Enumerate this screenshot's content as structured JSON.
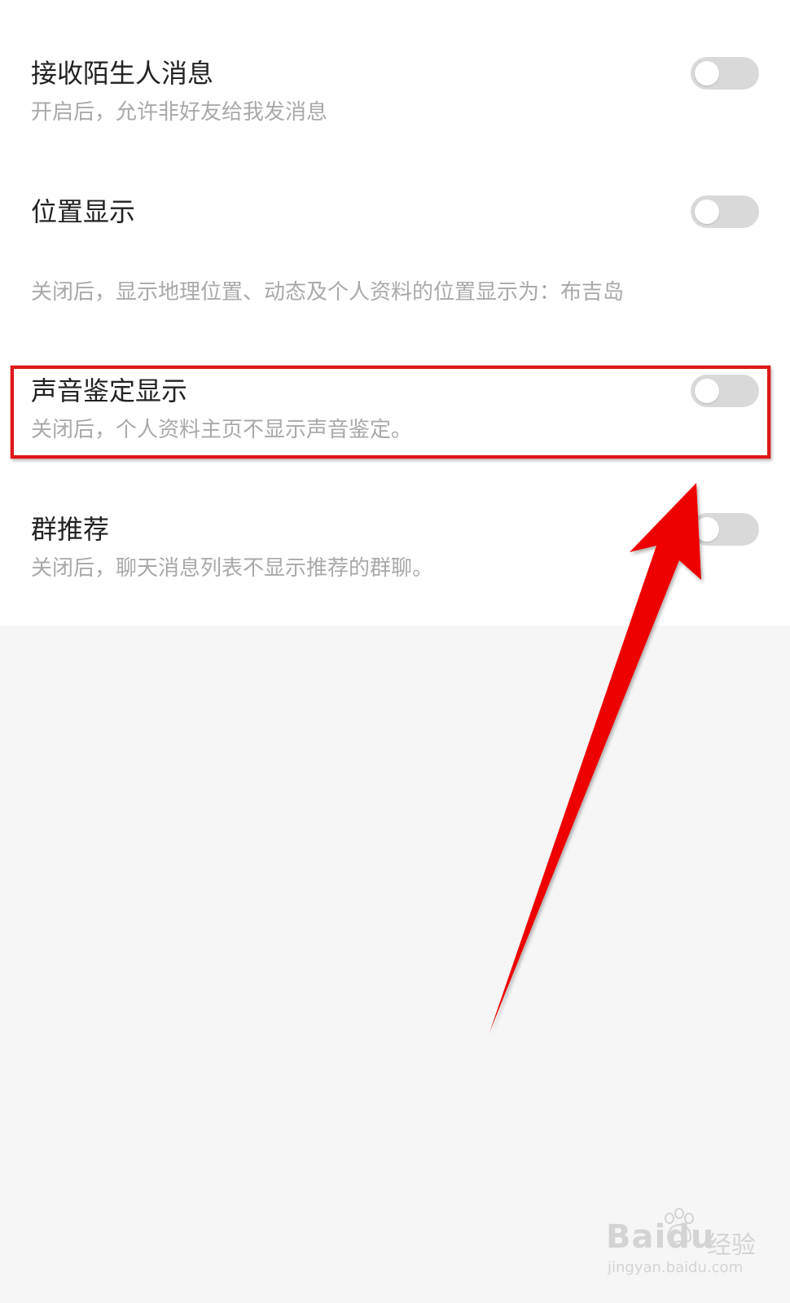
{
  "settings": [
    {
      "title": "接收陌生人消息",
      "description": "开启后，允许非好友给我发消息",
      "enabled": false
    },
    {
      "title": "位置显示",
      "description": "关闭后，显示地理位置、动态及个人资料的位置显示为：布吉岛",
      "enabled": false
    },
    {
      "title": "声音鉴定显示",
      "description": "关闭后，个人资料主页不显示声音鉴定。",
      "enabled": false
    },
    {
      "title": "群推荐",
      "description": "关闭后，聊天消息列表不显示推荐的群聊。",
      "enabled": false
    }
  ],
  "watermark": {
    "brand": "Baidu",
    "product": "经验",
    "url": "jingyan.baidu.com"
  },
  "colors": {
    "highlight": "#e01818",
    "arrow": "#ee0000",
    "toggle_off": "#d9d9d9"
  },
  "icons": {
    "annotation_arrow": "red-arrow-icon",
    "watermark_logo": "baidu-paw-icon"
  }
}
